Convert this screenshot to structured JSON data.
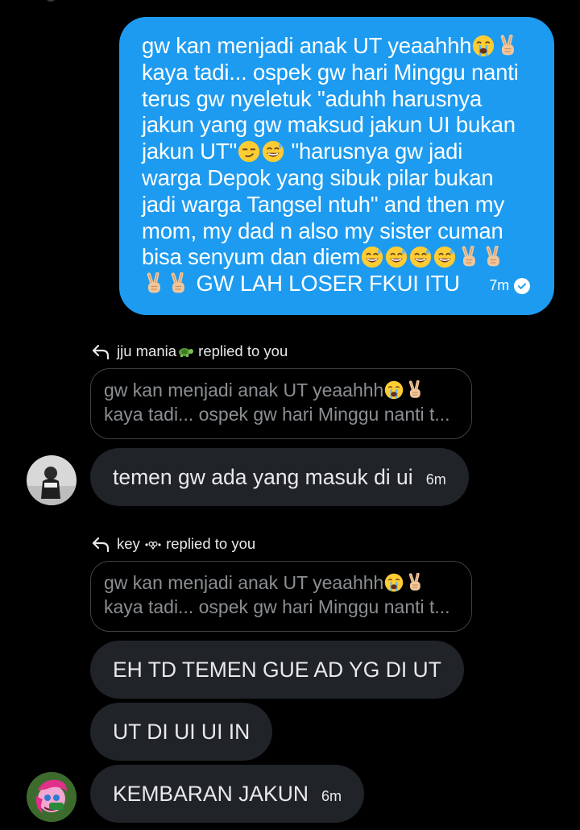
{
  "sent_message": {
    "lines": [
      "gw kan menjadi anak UT yeaahhh",
      "kaya tadi... ospek gw hari Minggu nanti",
      "terus gw nyeletuk \"aduhh harusnya",
      "jakun yang gw maksud jakun UI bukan",
      "jakun UT\"",
      " \"harusnya gw jadi",
      "warga Depok yang sibuk pilar bukan",
      "jadi warga Tangsel ntuh\" and then my",
      "mom, my dad n also my sister cuman",
      "bisa senyum dan diem",
      "GW LAH LOSER FKUI ITU"
    ],
    "time": "7m",
    "status_icon": "check-circle-icon",
    "emoji_names": [
      "loudly-crying-face",
      "victory-hand",
      "smirking-face",
      "grinning-sweat-face"
    ]
  },
  "replies": [
    {
      "label_name": "jju mania",
      "label_suffix": " replied to you",
      "label_emoji": "turtle",
      "quote_lines": [
        "gw kan menjadi anak UT yeaahhh",
        "kaya tadi... ospek gw hari Minggu nanti t..."
      ],
      "message": "temen gw ada yang masuk di ui",
      "time": "6m"
    },
    {
      "label_name": "key",
      "label_suffix": " replied to you",
      "label_emoji": "dot-ornament",
      "quote_lines": [
        "gw kan menjadi anak UT yeaahhh",
        "kaya tadi... ospek gw hari Minggu nanti t..."
      ],
      "messages": [
        "EH TD TEMEN GUE AD YG DI UT",
        "UT DI UI UI IN",
        "KEMBARAN JAKUN"
      ],
      "time": "6m"
    }
  ],
  "colors": {
    "background": "#000000",
    "sent_bubble": "#1d9bf0",
    "received_bubble": "#202327",
    "quote_border": "#3e4144",
    "muted_text": "#8b8f93"
  }
}
